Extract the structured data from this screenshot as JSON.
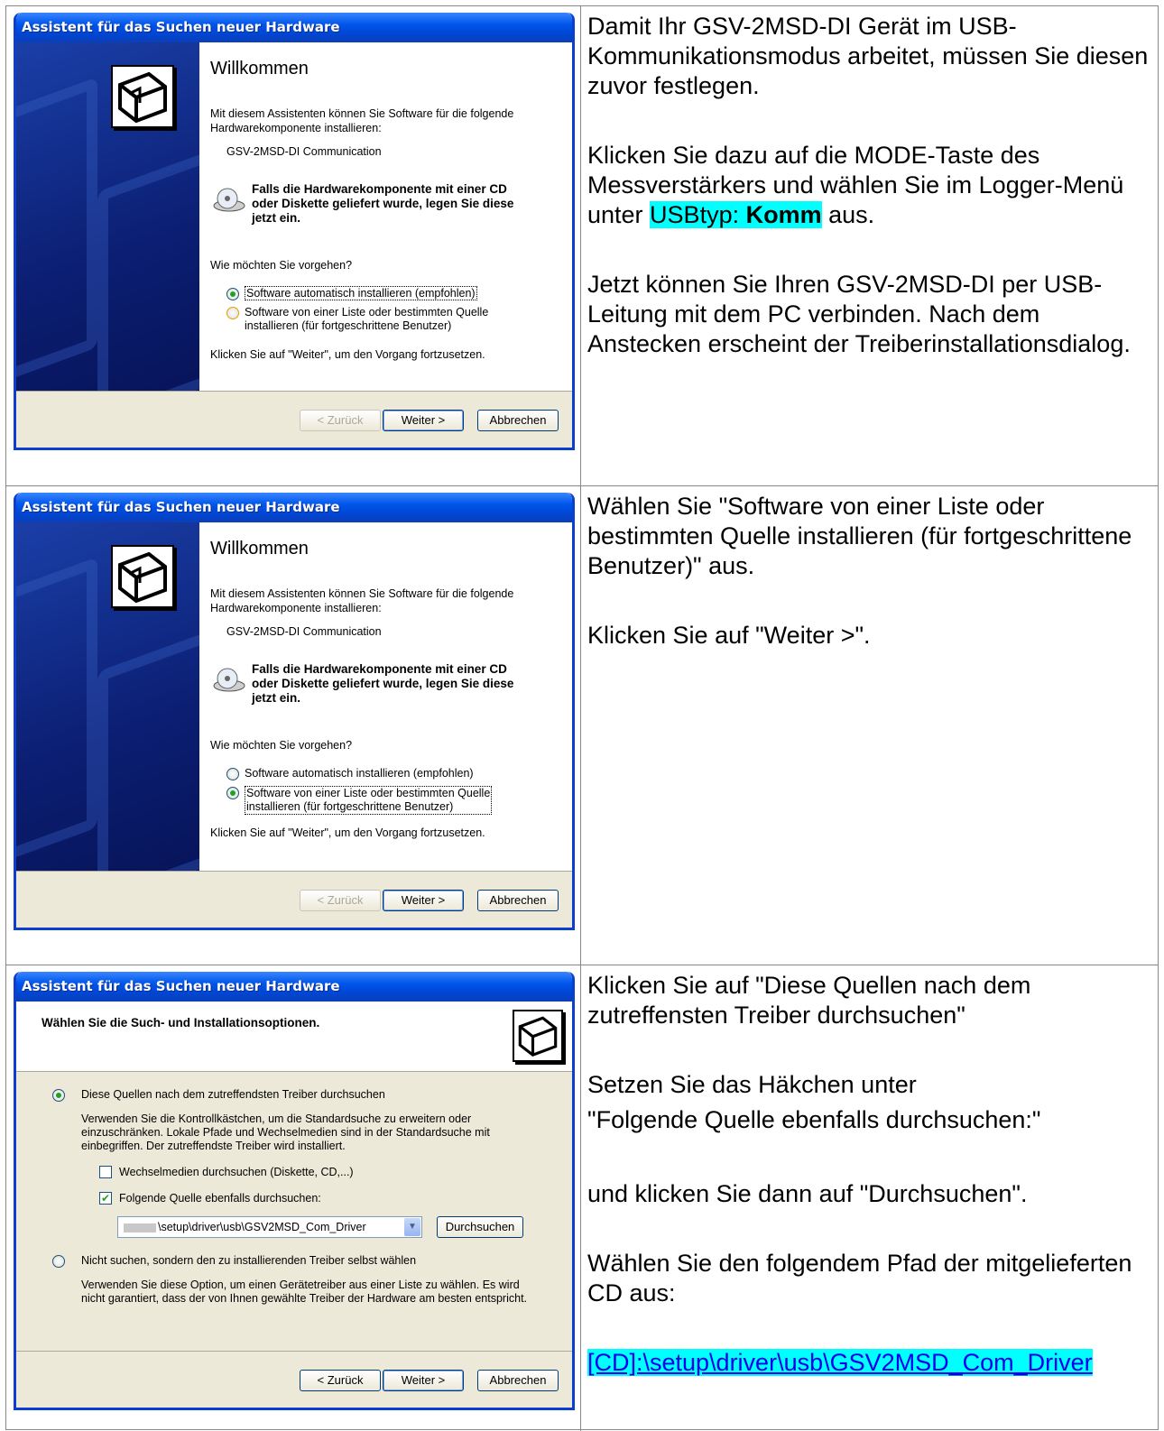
{
  "dialog": {
    "title": "Assistent für das Suchen neuer Hardware",
    "welcome_heading": "Willkommen",
    "intro_line1": "Mit diesem Assistenten können Sie Software für die folgende",
    "intro_line2": "Hardwarekomponente installieren:",
    "device_name": "GSV-2MSD-DI Communication",
    "cd_notice_line1": "Falls die Hardwarekomponente mit einer CD",
    "cd_notice_line2": "oder Diskette geliefert wurde, legen Sie diese",
    "cd_notice_line3": "jetzt ein.",
    "question": "Wie möchten Sie vorgehen?",
    "option_auto": "Software automatisch installieren (empfohlen)",
    "option_list_line1": "Software von einer Liste oder bestimmten Quelle",
    "option_list_line2": "installieren (für fortgeschrittene Benutzer)",
    "continue_hint": "Klicken Sie auf \"Weiter\", um den Vorgang fortzusetzen.",
    "back_button": "< Zurück",
    "next_button": "Weiter >",
    "cancel_button": "Abbrechen"
  },
  "dialog3": {
    "heading": "Wählen Sie die Such- und Installationsoptionen.",
    "option_search": "Diese Quellen nach dem zutreffendsten Treiber durchsuchen",
    "search_desc_line1": "Verwenden Sie die Kontrollkästchen, um die Standardsuche zu erweitern oder",
    "search_desc_line2": "einzuschränken. Lokale Pfade und Wechselmedien sind in der Standardsuche mit",
    "search_desc_line3": "einbegriffen. Der zutreffendste Treiber wird installiert.",
    "checkbox_removable": "Wechselmedien durchsuchen (Diskette, CD,...)",
    "checkbox_location": "Folgende Quelle ebenfalls durchsuchen:",
    "path_value": "\\setup\\driver\\usb\\GSV2MSD_Com_Driver",
    "browse_button": "Durchsuchen",
    "option_manual": "Nicht suchen, sondern den zu installierenden Treiber selbst wählen",
    "manual_desc_line1": "Verwenden Sie diese Option, um einen Gerätetreiber aus einer Liste zu wählen. Es wird",
    "manual_desc_line2": "nicht garantiert, dass der von Ihnen gewählte Treiber der Hardware am besten entspricht."
  },
  "instructions": {
    "row1_p1": "Damit Ihr GSV-2MSD-DI Gerät im USB-Kommunikationsmodus arbeitet, müssen Sie diesen zuvor festlegen.",
    "row1_p2_prefix": "Klicken Sie dazu auf die MODE-Taste des Messverstärkers und wählen Sie im Logger-Menü unter ",
    "row1_p2_hl": "USBtyp: ",
    "row1_p2_bold": "Komm",
    "row1_p2_suffix": " aus.",
    "row1_p3": "Jetzt können Sie Ihren GSV-2MSD-DI per USB-Leitung mit dem PC verbinden. Nach dem Anstecken erscheint der Treiberinstallationsdialog.",
    "row2_p1": "Wählen Sie \"Software von einer Liste oder bestimmten Quelle installieren (für fortgeschrittene Benutzer)\" aus.",
    "row2_p2": "Klicken Sie auf \"Weiter >\".",
    "row3_p1": "Klicken Sie auf \"Diese Quellen nach dem zutreffensten Treiber durchsuchen\"",
    "row3_p2_line1": "Setzen Sie das Häkchen unter",
    "row3_p2_line2": "\"Folgende Quelle ebenfalls durchsuchen:\"",
    "row3_p3": "und klicken Sie dann auf \"Durchsuchen\".",
    "row3_p4": "Wählen Sie den folgendem Pfad der mitgelieferten CD aus:",
    "row3_path": "[CD]:\\setup\\driver\\usb\\GSV2MSD_Com_Driver"
  },
  "colors": {
    "highlight": "#00ffff",
    "xp_blue": "#0055ea",
    "dialog_bg": "#ece9d8"
  }
}
